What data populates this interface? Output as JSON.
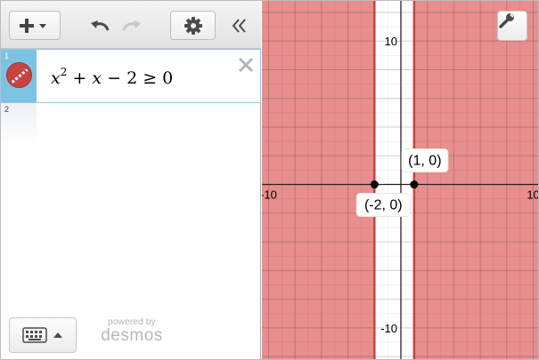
{
  "expressions": [
    {
      "number": "1",
      "color": "#c74440",
      "latex": "x^2 + x - 2 ≥ 0",
      "parts": {
        "var": "x",
        "exp": "2",
        "mid": " + ",
        "var2": "x",
        "tail": " − 2 ≥ 0"
      }
    },
    {
      "number": "2"
    }
  ],
  "toolbar": {
    "add_icon": "plus-icon",
    "undo_icon": "undo-icon",
    "redo_icon": "redo-icon",
    "settings_icon": "gear-icon",
    "collapse_icon": "double-chevron-left-icon"
  },
  "footer": {
    "powered_by": "powered by",
    "brand": "desmos"
  },
  "graph": {
    "x_range": [
      -10.5,
      10.5
    ],
    "y_range": [
      -12.3,
      12.8
    ],
    "shade_color": "#e88e8e",
    "boundary_color": "#c74440",
    "boundaries": [
      -2,
      1
    ],
    "shaded_intervals": [
      [
        -10.5,
        -2
      ],
      [
        1,
        10.5
      ]
    ],
    "grid_step": 2,
    "tick_labels": {
      "x_left": "-10",
      "x_right": "10",
      "y_top": "10",
      "y_bottom": "-10"
    },
    "points": [
      {
        "x": 1,
        "y": 0,
        "label": "(1, 0)"
      },
      {
        "x": -2,
        "y": 0,
        "label": "(-2, 0)"
      }
    ],
    "settings_icon": "wrench-icon"
  }
}
